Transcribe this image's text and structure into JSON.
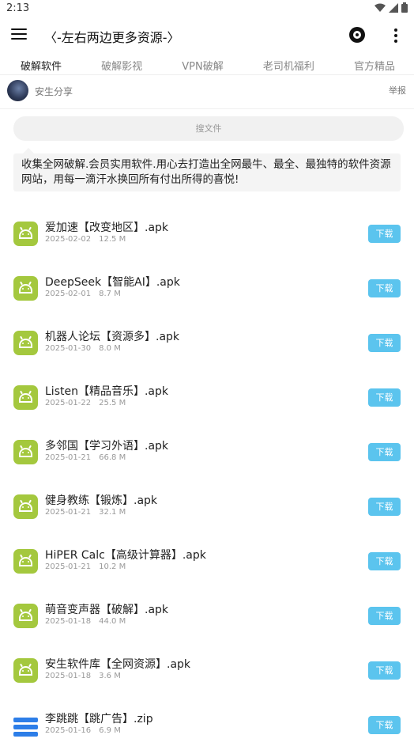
{
  "status_bar": {
    "time": "2:13"
  },
  "app_bar": {
    "title": "〈-左右两边更多资源-〉"
  },
  "tabs": [
    {
      "label": "破解软件",
      "active": true
    },
    {
      "label": "破解影视",
      "active": false
    },
    {
      "label": "VPN破解",
      "active": false
    },
    {
      "label": "老司机福利",
      "active": false
    },
    {
      "label": "官方精品",
      "active": false
    }
  ],
  "author": {
    "name": "安生分享",
    "report_label": "举报"
  },
  "search": {
    "placeholder": "搜文件"
  },
  "description": "收集全网破解.会员实用软件.用心去打造出全网最牛、最全、最独特的软件资源网站，用每一滴汗水换回所有付出所得的喜悦!",
  "download_label": "下载",
  "files": [
    {
      "name": "爱加速【改变地区】.apk",
      "date": "2025-02-02",
      "size": "12.5 M",
      "icon": "android-icon"
    },
    {
      "name": "DeepSeek【智能AI】.apk",
      "date": "2025-02-01",
      "size": "8.7 M",
      "icon": "android-icon"
    },
    {
      "name": "机器人论坛【资源多】.apk",
      "date": "2025-01-30",
      "size": "8.0 M",
      "icon": "android-icon"
    },
    {
      "name": "Listen【精品音乐】.apk",
      "date": "2025-01-22",
      "size": "25.5 M",
      "icon": "android-icon"
    },
    {
      "name": "多邻国【学习外语】.apk",
      "date": "2025-01-21",
      "size": "66.8 M",
      "icon": "android-icon"
    },
    {
      "name": "健身教练【锻炼】.apk",
      "date": "2025-01-21",
      "size": "32.1 M",
      "icon": "android-icon"
    },
    {
      "name": "HiPER Calc【高级计算器】.apk",
      "date": "2025-01-21",
      "size": "10.2 M",
      "icon": "android-icon"
    },
    {
      "name": "萌音变声器【破解】.apk",
      "date": "2025-01-18",
      "size": "44.0 M",
      "icon": "android-icon"
    },
    {
      "name": "安生软件库【全网资源】.apk",
      "date": "2025-01-18",
      "size": "3.6 M",
      "icon": "android-icon"
    },
    {
      "name": "李跳跳【跳广告】.zip",
      "date": "2025-01-16",
      "size": "6.9 M",
      "icon": "zip-icon"
    }
  ],
  "colors": {
    "accent": "#5bc4ee",
    "android": "#a4c83e",
    "zip": "#2d7ee8"
  }
}
